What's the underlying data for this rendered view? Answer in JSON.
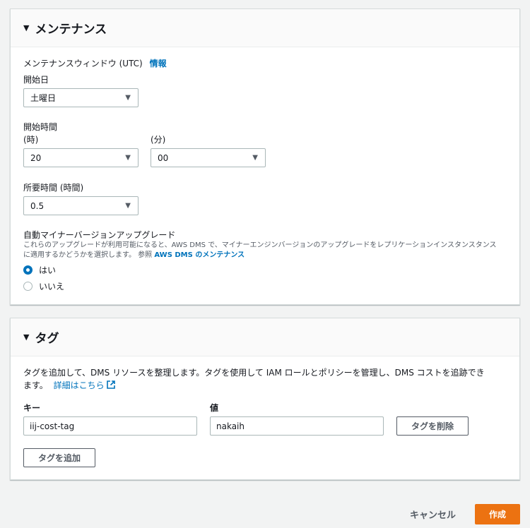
{
  "maintenance": {
    "title": "メンテナンス",
    "window_label": "メンテナンスウィンドウ (UTC)",
    "info_link": "情報",
    "start_day_label": "開始日",
    "start_day_value": "土曜日",
    "start_time_label": "開始時間",
    "hour_label": "(時)",
    "hour_value": "20",
    "minute_label": "(分)",
    "minute_value": "00",
    "duration_label": "所要時間 (時間)",
    "duration_value": "0.5",
    "auto_upgrade_label": "自動マイナーバージョンアップグレード",
    "auto_upgrade_desc_line1": "これらのアップグレードが利用可能になると、AWS DMS で、マイナーエンジンバージョンのアップグレードをレプリケーションインスタンスタンス",
    "auto_upgrade_desc_line2": "に適用するかどうかを選択します。 参照",
    "auto_upgrade_ref_link": "AWS DMS のメンテナンス",
    "radio_yes": "はい",
    "radio_no": "いいえ"
  },
  "tags": {
    "title": "タグ",
    "desc_line1": "タグを追加して、DMS リソースを整理します。タグを使用して IAM ロールとポリシーを管理し、DMS コストを追跡でき",
    "desc_line2": "ます。",
    "learn_more": "詳細はこちら",
    "key_label": "キー",
    "value_label": "値",
    "key_value": "iij-cost-tag",
    "value_value": "nakaih",
    "remove_button": "タグを削除",
    "add_button": "タグを追加"
  },
  "footer": {
    "cancel": "キャンセル",
    "create": "作成"
  }
}
